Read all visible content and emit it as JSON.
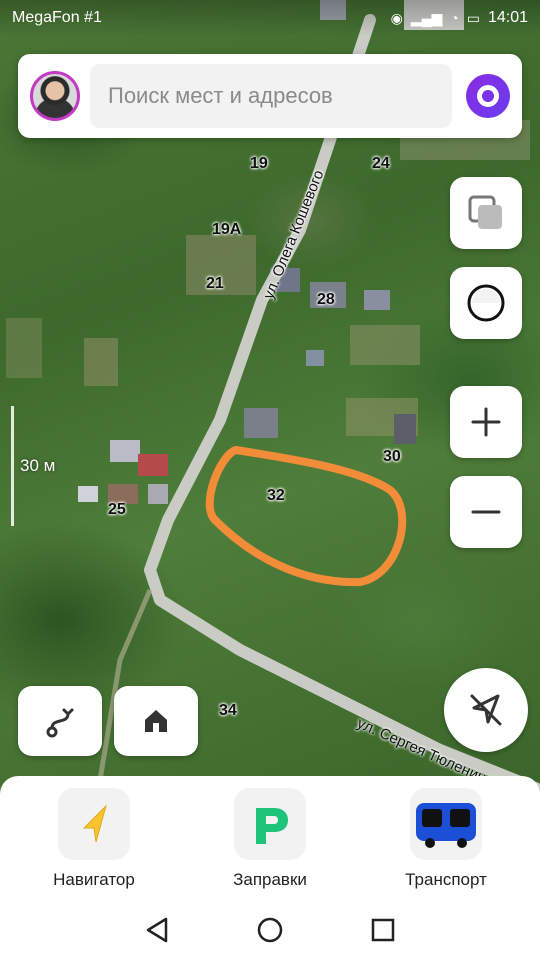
{
  "status_bar": {
    "carrier": "MegaFon #1",
    "time": "14:01",
    "icons": [
      "eye-icon",
      "signal-icon",
      "wifi-icon",
      "battery-icon"
    ]
  },
  "search": {
    "placeholder": "Поиск мест и адресов"
  },
  "map": {
    "house_numbers": [
      "19",
      "24",
      "19А",
      "21",
      "28",
      "30",
      "32",
      "25",
      "34"
    ],
    "streets": [
      "ул. Олега Кошевого",
      "ул. Сергея Тюленина"
    ],
    "scale": "30 м",
    "highlight_color": "#f28c38"
  },
  "controls": {
    "layers_icon": "layers-icon",
    "aon_icon": "ring-icon",
    "zoom_in_icon": "plus-icon",
    "zoom_out_icon": "minus-icon",
    "route_icon": "route-icon",
    "home_icon": "home-icon",
    "location_icon": "location-off-icon"
  },
  "shortcuts": [
    {
      "label": "Навигатор",
      "icon": "navigator-icon"
    },
    {
      "label": "Заправки",
      "icon": "fuel-icon"
    },
    {
      "label": "Транспорт",
      "icon": "bus-icon"
    }
  ],
  "colors": {
    "alice": "#7a34e8",
    "fuel_green": "#1ec47a",
    "bus_blue": "#1b4fd6",
    "navigator_yellow": "#f7c32e"
  }
}
